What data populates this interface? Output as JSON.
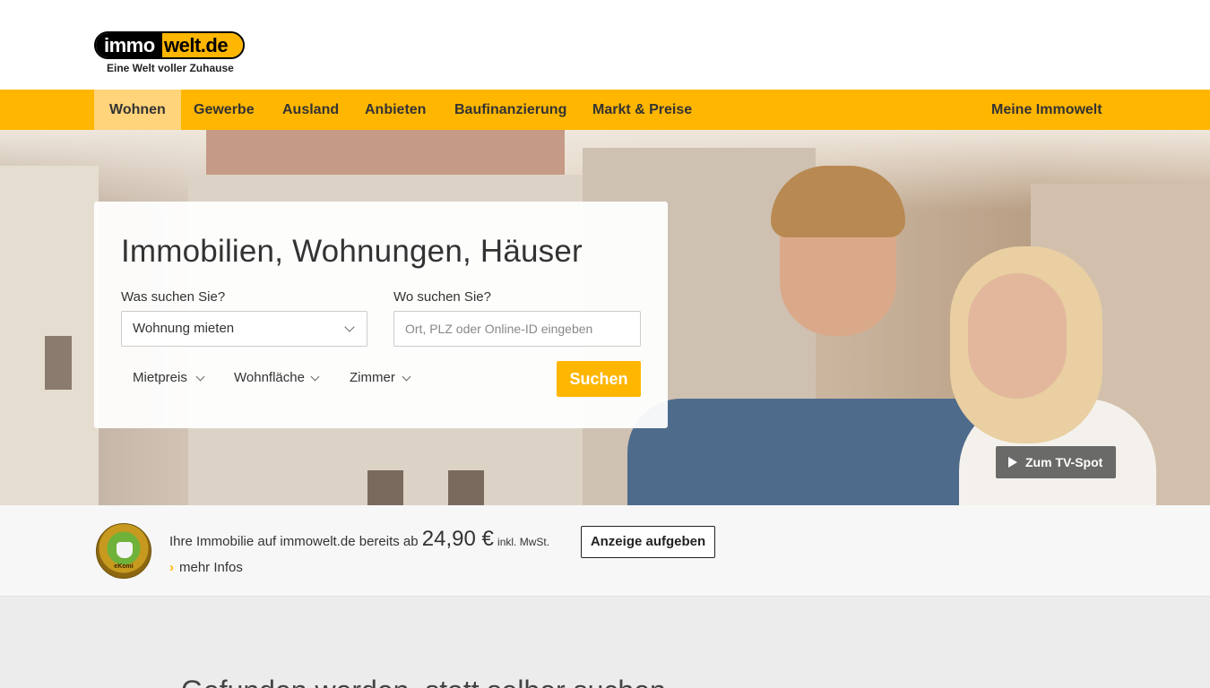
{
  "brand": {
    "logo_left": "immo",
    "logo_right": "welt.de",
    "tagline": "Eine Welt voller Zuhause"
  },
  "nav": {
    "items": [
      {
        "label": "Wohnen",
        "active": true
      },
      {
        "label": "Gewerbe",
        "active": false
      },
      {
        "label": "Ausland",
        "active": false
      },
      {
        "label": "Anbieten",
        "active": false
      },
      {
        "label": "Baufinanzierung",
        "active": false
      },
      {
        "label": "Markt & Preise",
        "active": false
      }
    ],
    "account_label": "Meine Immowelt"
  },
  "search": {
    "title": "Immobilien, Wohnungen, Häuser",
    "what_label": "Was suchen Sie?",
    "what_value": "Wohnung mieten",
    "where_label": "Wo suchen Sie?",
    "where_placeholder": "Ort, PLZ oder Online-ID eingeben",
    "filters": [
      "Mietpreis",
      "Wohnfläche",
      "Zimmer"
    ],
    "submit_label": "Suchen"
  },
  "hero": {
    "tv_spot_label": "Zum TV-Spot"
  },
  "promo": {
    "badge_text": "eKomi",
    "text_prefix": "Ihre Immobilie auf immowelt.de bereits ab",
    "price": "24,90 €",
    "price_suffix": "inkl. MwSt.",
    "more_label": "mehr Infos",
    "cta_label": "Anzeige aufgeben"
  },
  "section": {
    "heading": "Gefunden werden, statt selber suchen"
  },
  "colors": {
    "accent": "#ffb600",
    "nav_active": "#ffd47a"
  }
}
